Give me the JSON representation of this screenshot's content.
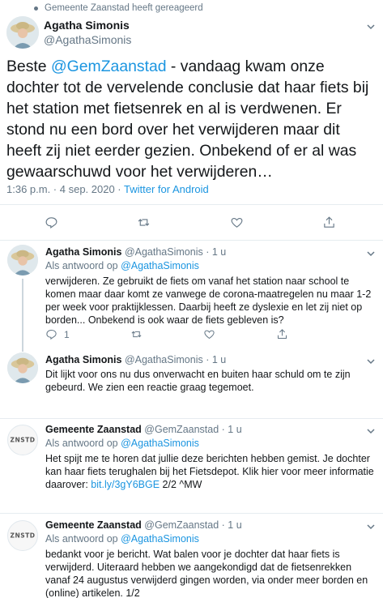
{
  "top_context": {
    "text": "Gemeente Zaanstad heeft gereageerd"
  },
  "main_tweet": {
    "name": "Agatha Simonis",
    "handle": "@AgathaSimonis",
    "text_prefix": "Beste ",
    "mention": "@GemZaanstad",
    "text_body": " - vandaag kwam onze dochter tot de vervelende conclusie dat haar fiets bij het station met fietsenrek en al is verdwenen. Er stond nu een bord over het verwijderen maar dit heeft zij niet eerder gezien. Onbekend of er al was gewaarschuwd voor het verwijderen…",
    "time": "1:36 p.m. · 4 sep. 2020 · ",
    "source": "Twitter for Android"
  },
  "replies": [
    {
      "name": "Agatha Simonis",
      "handle": "@AgathaSimonis",
      "time": "· 1 u",
      "reply_to_label": "Als antwoord op ",
      "reply_to_handle": "@AgathaSimonis",
      "text": "verwijderen. Ze gebruikt de fiets om vanaf het station naar school te komen maar daar komt ze vanwege de corona-maatregelen nu maar 1-2 per week voor praktijklessen. Daarbij heeft ze dyslexie en let zij niet op borden... Onbekend is ook waar de fiets gebleven is?",
      "reply_count": "1"
    },
    {
      "name": "Agatha Simonis",
      "handle": "@AgathaSimonis",
      "time": "· 1 u",
      "text": "Dit lijkt voor ons nu dus onverwacht en buiten haar schuld om te zijn gebeurd. We zien een reactie graag tegemoet."
    },
    {
      "name": "Gemeente Zaanstad",
      "handle": "@GemZaanstad",
      "time": "· 1 u",
      "reply_to_label": "Als antwoord op ",
      "reply_to_handle": "@AgathaSimonis",
      "text": "Het spijt me te horen dat jullie deze berichten hebben gemist. Je dochter kan haar fiets terughalen bij het Fietsdepot. Klik hier voor meer informatie daarover: ",
      "link": "bit.ly/3gY6BGE",
      "text_suffix": "  2/2 ^MW",
      "logo": "ZNSTD"
    },
    {
      "name": "Gemeente Zaanstad",
      "handle": "@GemZaanstad",
      "time": "· 1 u",
      "reply_to_label": "Als antwoord op ",
      "reply_to_handle": "@AgathaSimonis",
      "text": "bedankt voor je bericht. Wat balen voor je dochter dat haar fiets is verwijderd. Uiteraard hebben we aangekondigd dat de fietsenrekken vanaf 24 augustus verwijderd gingen worden, via onder meer borden en (online) artikelen. 1/2",
      "logo": "ZNSTD"
    }
  ],
  "icons": {
    "reply": "reply-icon",
    "retweet": "retweet-icon",
    "like": "like-icon",
    "share": "share-icon",
    "more": "chevron-down-icon"
  }
}
